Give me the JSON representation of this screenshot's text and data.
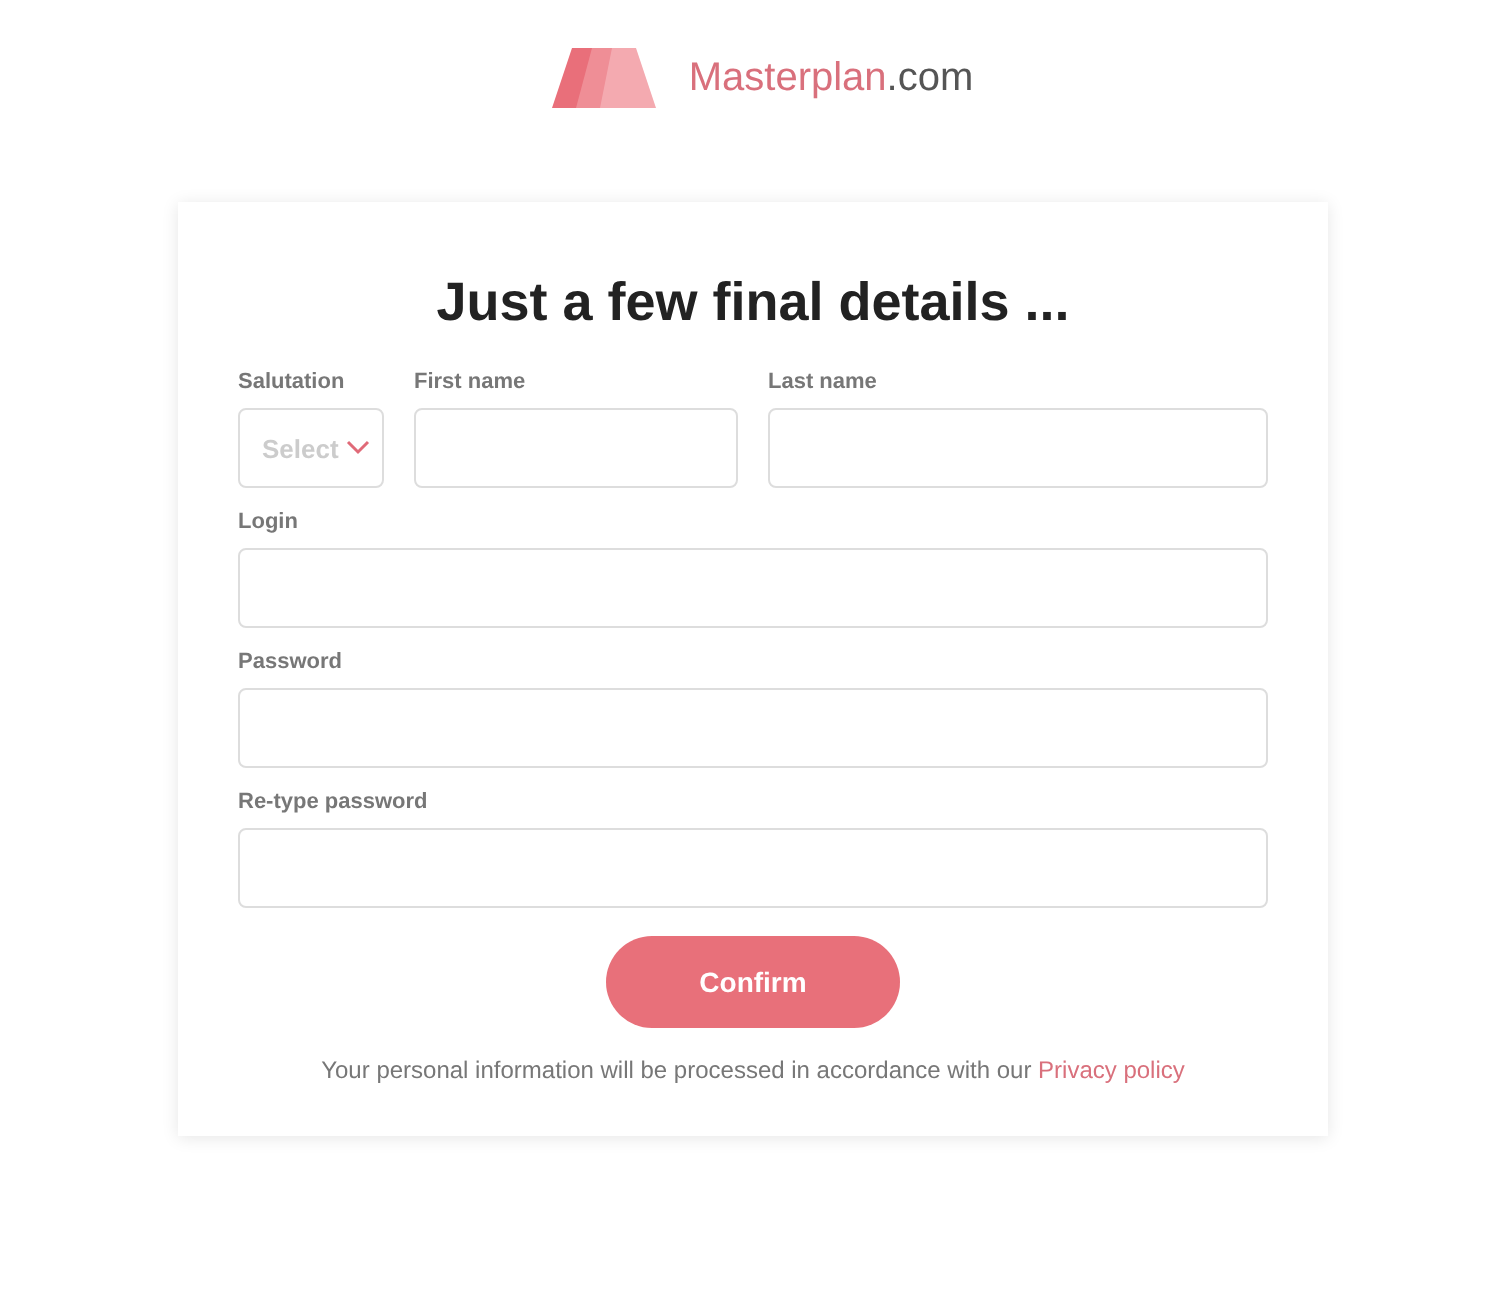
{
  "logo": {
    "name": "Masterplan",
    "suffix": ".com"
  },
  "title": "Just a few final details ...",
  "name_row": [
    {
      "label": "Salutation",
      "kind": "select",
      "placeholder": "Select"
    },
    {
      "label": "First name",
      "kind": "text"
    },
    {
      "label": "Last name",
      "kind": "text"
    }
  ],
  "fields": [
    {
      "label": "Login"
    },
    {
      "label": "Password"
    },
    {
      "label": "Re-type password"
    }
  ],
  "confirm_button": "Confirm",
  "notice": {
    "text": "Your personal information will be processed in accordance with our ",
    "link": "Privacy policy"
  }
}
